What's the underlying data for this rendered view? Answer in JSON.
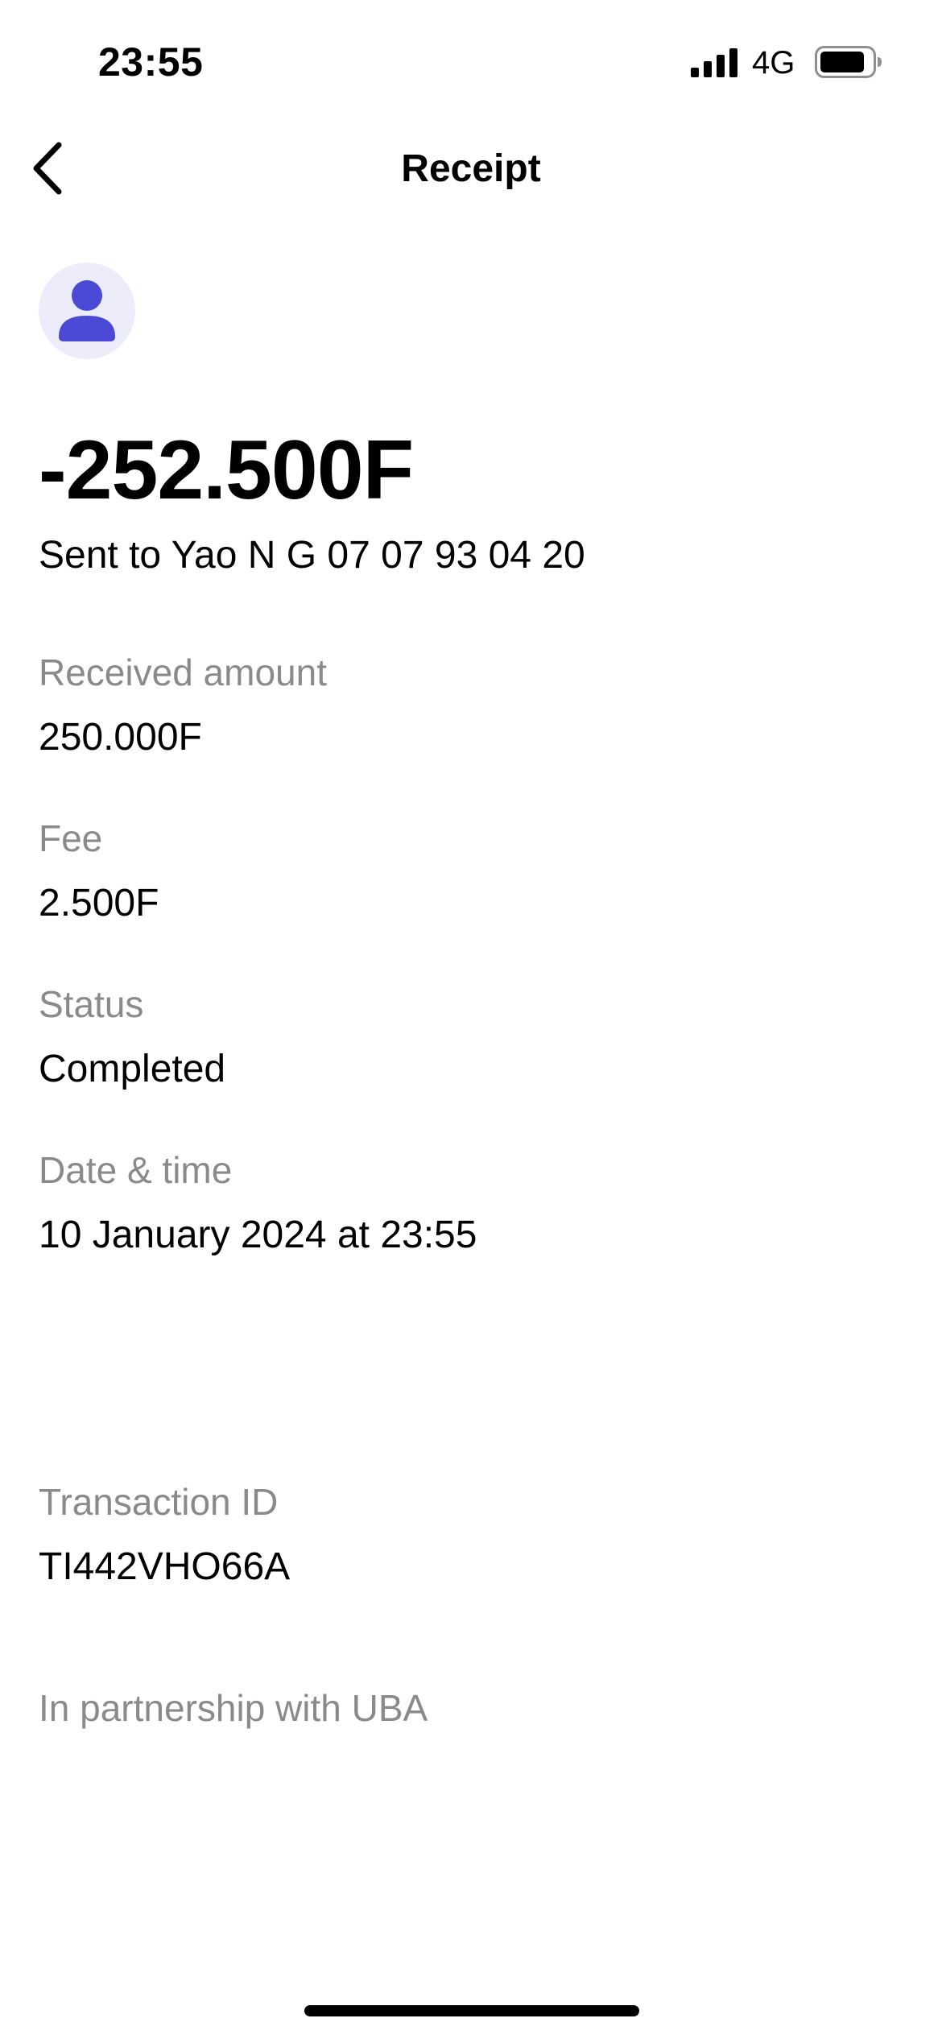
{
  "status_bar": {
    "time": "23:55",
    "network": "4G",
    "icons": [
      "signal-icon",
      "battery-icon"
    ]
  },
  "nav": {
    "title": "Receipt",
    "back_icon": "chevron-left-icon"
  },
  "avatar": {
    "icon": "user-icon",
    "bg_color": "#ececfb",
    "icon_color": "#4a4ad6"
  },
  "transaction": {
    "amount": "-252.500F",
    "sent_to": "Sent to Yao N G 07 07 93 04 20"
  },
  "details": {
    "received_amount": {
      "label": "Received amount",
      "value": "250.000F"
    },
    "fee": {
      "label": "Fee",
      "value": "2.500F"
    },
    "status": {
      "label": "Status",
      "value": "Completed"
    },
    "date_time": {
      "label": "Date & time",
      "value": "10 January 2024 at 23:55"
    },
    "transaction_id": {
      "label": "Transaction ID",
      "value": "TI442VHO66A"
    }
  },
  "footer": {
    "partnership": "In partnership with UBA"
  },
  "colors": {
    "label_gray": "#8a8a8e",
    "text": "#000000",
    "background": "#ffffff"
  }
}
